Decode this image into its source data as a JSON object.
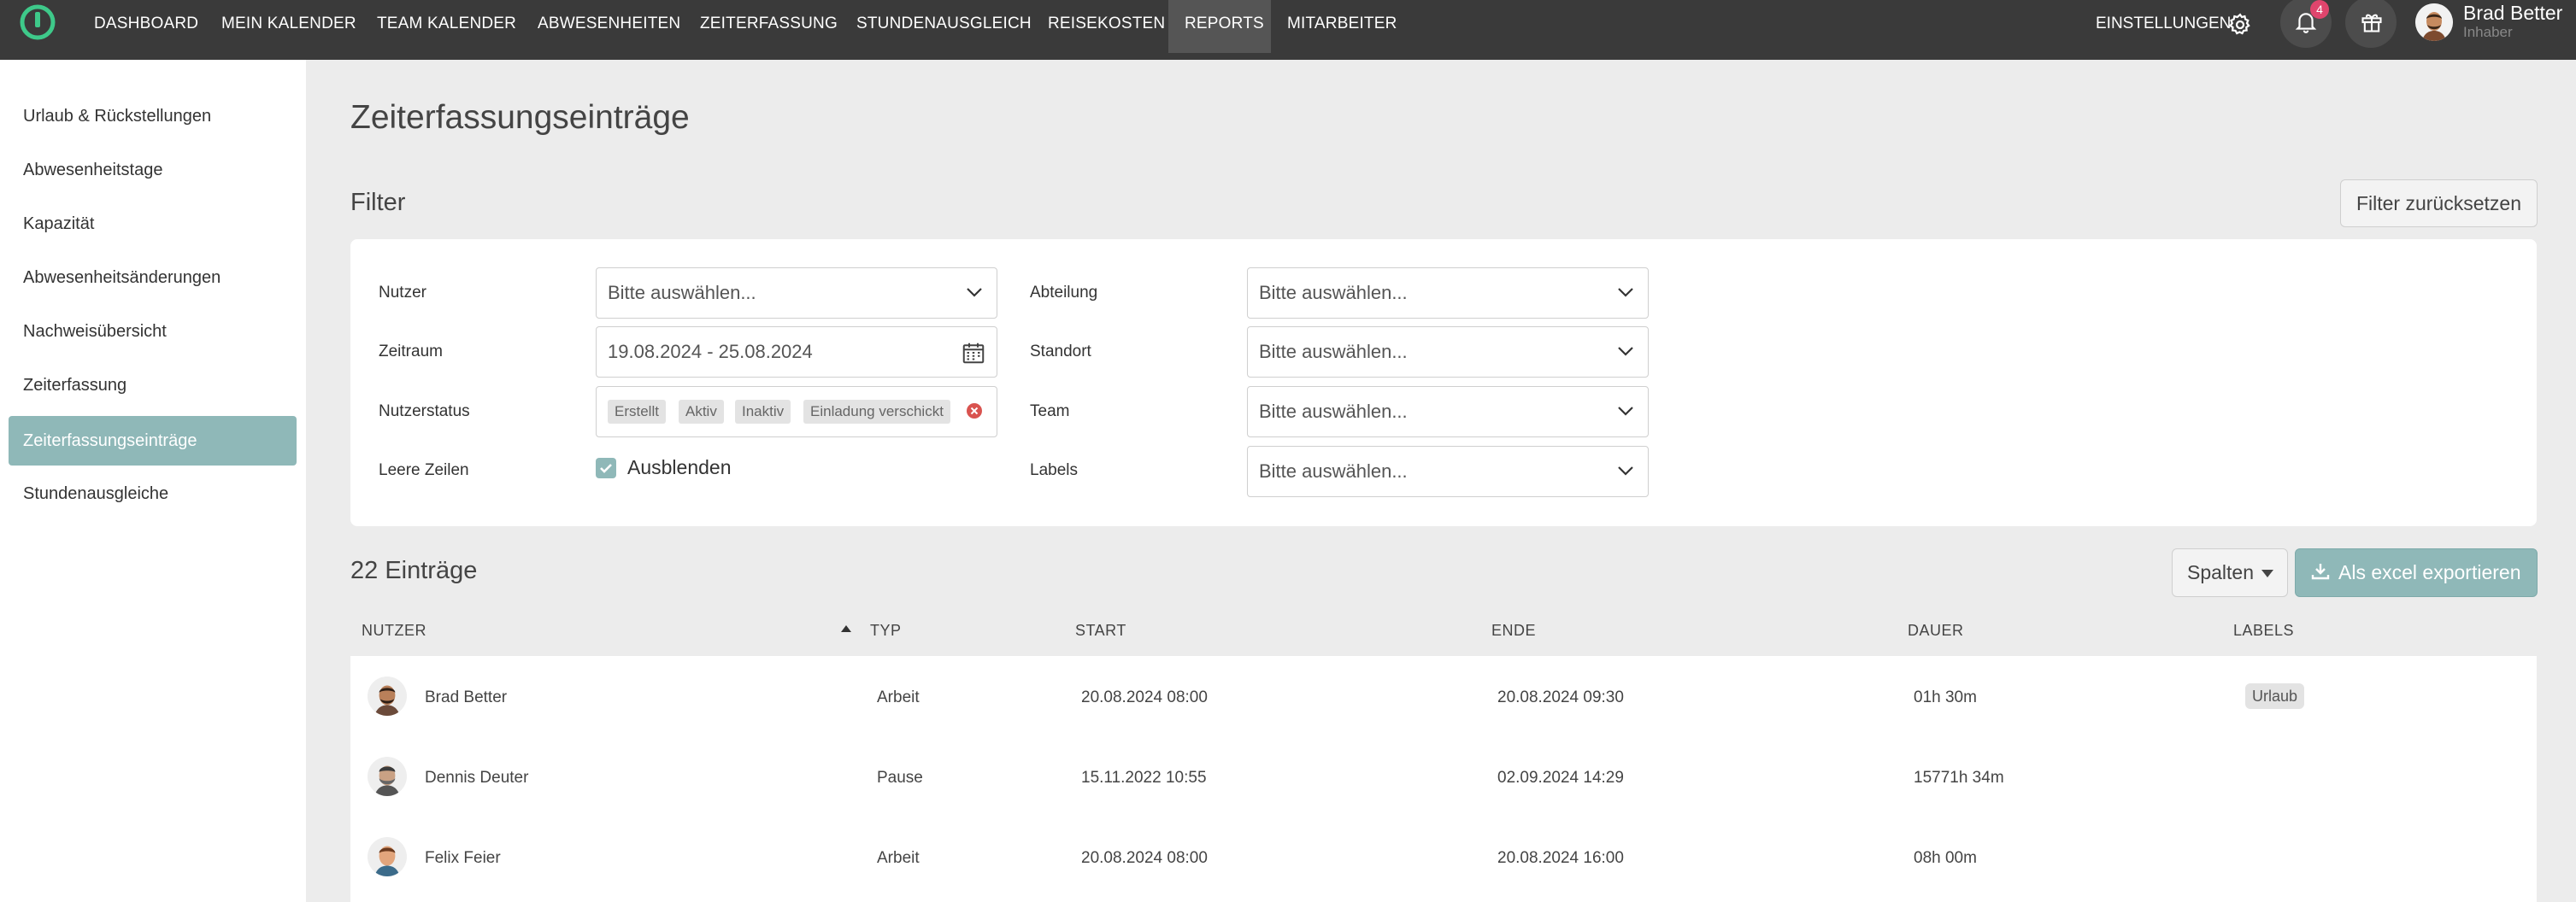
{
  "nav": {
    "items": [
      {
        "label": "DASHBOARD"
      },
      {
        "label": "MEIN KALENDER"
      },
      {
        "label": "TEAM KALENDER"
      },
      {
        "label": "ABWESENHEITEN"
      },
      {
        "label": "ZEITERFASSUNG"
      },
      {
        "label": "STUNDENAUSGLEICH"
      },
      {
        "label": "REISEKOSTEN"
      },
      {
        "label": "REPORTS"
      },
      {
        "label": "MITARBEITER"
      }
    ],
    "active": "REPORTS",
    "settings_label": "EINSTELLUNGEN",
    "notification_count": "4",
    "user_name": "Brad Better",
    "user_role": "Inhaber"
  },
  "sidebar": {
    "items": [
      {
        "label": "Urlaub & Rückstellungen"
      },
      {
        "label": "Abwesenheitstage"
      },
      {
        "label": "Kapazität"
      },
      {
        "label": "Abwesenheitsänderungen"
      },
      {
        "label": "Nachweisübersicht"
      },
      {
        "label": "Zeiterfassung"
      },
      {
        "label": "Zeiterfassungseinträge"
      },
      {
        "label": "Stundenausgleiche"
      }
    ],
    "active": "Zeiterfassungseinträge"
  },
  "page": {
    "title": "Zeiterfassungseinträge",
    "filter_title": "Filter",
    "reset_label": "Filter zurücksetzen"
  },
  "filters": {
    "user": {
      "label": "Nutzer",
      "value": "Bitte auswählen..."
    },
    "period": {
      "label": "Zeitraum",
      "value": "19.08.2024 - 25.08.2024"
    },
    "user_status": {
      "label": "Nutzerstatus",
      "tags": [
        "Erstellt",
        "Aktiv",
        "Inaktiv",
        "Einladung verschickt"
      ]
    },
    "empty_rows": {
      "label": "Leere Zeilen",
      "option": "Ausblenden",
      "checked": true
    },
    "department": {
      "label": "Abteilung",
      "value": "Bitte auswählen..."
    },
    "location": {
      "label": "Standort",
      "value": "Bitte auswählen..."
    },
    "team": {
      "label": "Team",
      "value": "Bitte auswählen..."
    },
    "labels": {
      "label": "Labels",
      "value": "Bitte auswählen..."
    }
  },
  "results": {
    "count_label": "22 Einträge",
    "columns_label": "Spalten",
    "export_label": "Als excel exportieren"
  },
  "table": {
    "headers": [
      "NUTZER",
      "TYP",
      "START",
      "ENDE",
      "DAUER",
      "LABELS"
    ],
    "sort_column": "NUTZER",
    "rows": [
      {
        "user": "Brad Better",
        "type": "Arbeit",
        "start": "20.08.2024 08:00",
        "end": "20.08.2024 09:30",
        "duration": "01h 30m",
        "label": "Urlaub"
      },
      {
        "user": "Dennis Deuter",
        "type": "Pause",
        "start": "15.11.2022 10:55",
        "end": "02.09.2024 14:29",
        "duration": "15771h 34m",
        "label": ""
      },
      {
        "user": "Felix Feier",
        "type": "Arbeit",
        "start": "20.08.2024 08:00",
        "end": "20.08.2024 16:00",
        "duration": "08h 00m",
        "label": ""
      }
    ]
  },
  "colors": {
    "topbar": "#3a3a3a",
    "accent": "#8fb8b8",
    "badge": "#e0456d",
    "logo": "#3ec98a"
  }
}
